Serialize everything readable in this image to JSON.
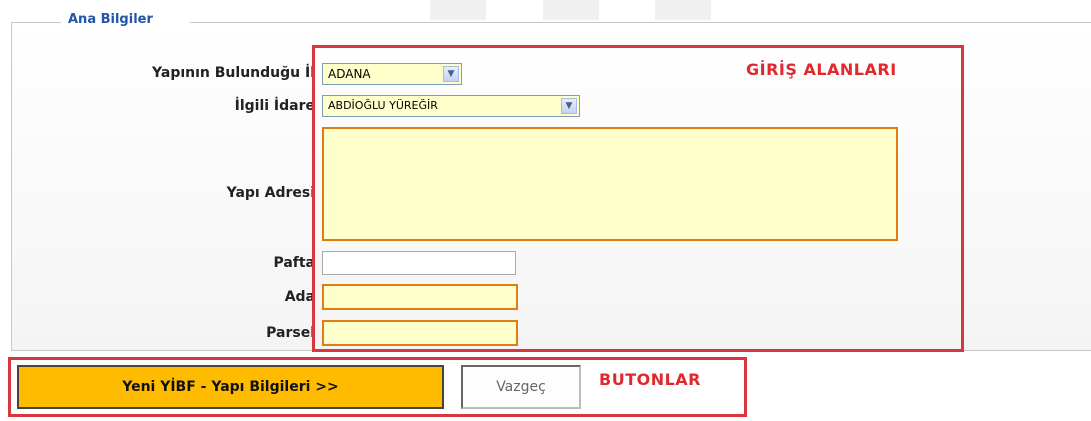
{
  "section": {
    "legend": "Ana Bilgiler"
  },
  "form": {
    "il_label": "Yapının Bulunduğu İl",
    "il_value": "ADANA",
    "idare_label": "İlgili İdare",
    "idare_value": "ABDİOĞLU YÜREĞİR",
    "adres_label": "Yapı Adresi",
    "adres_value": "",
    "pafta_label": "Pafta",
    "pafta_value": "",
    "ada_label": "Ada",
    "ada_value": "",
    "parsel_label": "Parsel",
    "parsel_value": "",
    "colon": ":"
  },
  "annotations": {
    "inputs_label": "GİRİŞ ALANLARI",
    "buttons_label": "BUTONLAR"
  },
  "buttons": {
    "primary": "Yeni YİBF - Yapı Bilgileri >>",
    "secondary": "Vazgeç"
  },
  "colors": {
    "input_bg": "#ffffcc",
    "input_border": "#e07d10",
    "annotation_red": "#d9363e",
    "primary_button": "#ffbb00",
    "legend_blue": "#2255aa"
  }
}
